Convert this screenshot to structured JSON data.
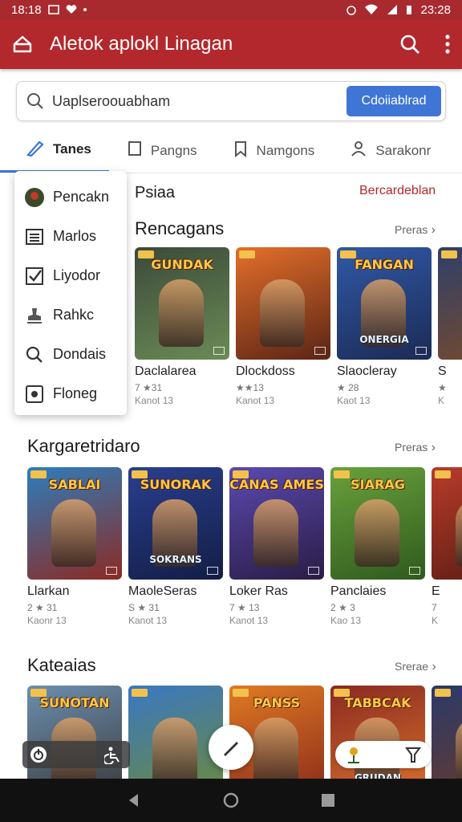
{
  "status_bar": {
    "time_left": "18:18",
    "time_right": "23:28"
  },
  "app_bar": {
    "title": "Aletok aplokl Linagan"
  },
  "search": {
    "value": "Uaplseroouabham",
    "button_label": "Cdoiiablrad"
  },
  "tabs": [
    {
      "label": "Tanes",
      "icon": "pen-icon"
    },
    {
      "label": "Pangns",
      "icon": "page-icon"
    },
    {
      "label": "Namgons",
      "icon": "bookmark-icon"
    },
    {
      "label": "Sarakonr",
      "icon": "person-icon"
    }
  ],
  "menu": {
    "items": [
      {
        "label": "Pencakn",
        "icon": "avatar-icon"
      },
      {
        "label": "Marlos",
        "icon": "list-icon"
      },
      {
        "label": "Liyodor",
        "icon": "checkbox-icon"
      },
      {
        "label": "Rahkc",
        "icon": "stamp-icon"
      },
      {
        "label": "Dondais",
        "icon": "search-icon"
      },
      {
        "label": "Floneg",
        "icon": "radio-icon"
      }
    ]
  },
  "header_row": {
    "label": "Psiaa",
    "link": "Bercardeblan"
  },
  "sections": [
    {
      "title": "Rencagans",
      "more": "Preras",
      "cards": [
        {
          "title": "Daclalarea",
          "rating": "7 ★31",
          "sub": "Kanot 13",
          "art_title": "GUNDAK",
          "art_bottom": "",
          "colors": [
            "#3b4a3a",
            "#6b8b56"
          ]
        },
        {
          "title": "Dlockdoss",
          "rating": "★★13",
          "sub": "Kanot 13",
          "art_title": "",
          "art_bottom": "",
          "colors": [
            "#e46f2a",
            "#5a2416"
          ]
        },
        {
          "title": "Slaocleray",
          "rating": "★ 28",
          "sub": "Kaot 13",
          "art_title": "FANGAN",
          "art_bottom": "ONERGIA",
          "colors": [
            "#3059a6",
            "#1c2a55"
          ]
        },
        {
          "title": "S",
          "rating": "★",
          "sub": "K",
          "art_title": "",
          "art_bottom": "",
          "colors": [
            "#2f3f6a",
            "#7a4b2a"
          ]
        }
      ]
    },
    {
      "title": "Kargaretridaro",
      "more": "Preras",
      "cards": [
        {
          "title": "Llarkan",
          "rating": "2 ★ 31",
          "sub": "Kaonr 13",
          "art_title": "SABLAI",
          "art_bottom": "",
          "colors": [
            "#2d7dbd",
            "#8c2a22"
          ]
        },
        {
          "title": "MaoleSeras",
          "rating": "S ★ 31",
          "sub": "Kanot 13",
          "art_title": "SUNORAK",
          "art_bottom": "SOKRANS",
          "colors": [
            "#2a3f8f",
            "#121d45"
          ]
        },
        {
          "title": "Loker Ras",
          "rating": "7 ★ 13",
          "sub": "Kanot 13",
          "art_title": "CANAS AMES",
          "art_bottom": "",
          "colors": [
            "#5a4ab0",
            "#2a1c45"
          ]
        },
        {
          "title": "Panclaies",
          "rating": "2 ★ 3",
          "sub": "Kao 13",
          "art_title": "SIARAG",
          "art_bottom": "",
          "colors": [
            "#69a13c",
            "#2f5a1d"
          ]
        },
        {
          "title": "E",
          "rating": "7",
          "sub": "K",
          "art_title": "",
          "art_bottom": "",
          "colors": [
            "#b83b2a",
            "#5a1d14"
          ]
        }
      ]
    },
    {
      "title": "Kateaias",
      "more": "Sreraе",
      "cards": [
        {
          "title": "",
          "rating": "",
          "sub": "",
          "art_title": "SUNOTAN",
          "art_bottom": "",
          "colors": [
            "#6c8fb0",
            "#3a3a3a"
          ]
        },
        {
          "title": "",
          "rating": "",
          "sub": "",
          "art_title": "",
          "art_bottom": "",
          "colors": [
            "#3a78c4",
            "#6b8a3a"
          ]
        },
        {
          "title": "",
          "rating": "",
          "sub": "",
          "art_title": "PANSS",
          "art_bottom": "",
          "colors": [
            "#e07a24",
            "#8a2a1a"
          ]
        },
        {
          "title": "",
          "rating": "",
          "sub": "",
          "art_title": "TABBCAK",
          "art_bottom": "GRUDAN",
          "colors": [
            "#8a2a22",
            "#d9702a"
          ]
        },
        {
          "title": "",
          "rating": "",
          "sub": "",
          "art_title": "",
          "art_bottom": "",
          "colors": [
            "#2a3a6a",
            "#6a3a2a"
          ]
        }
      ]
    }
  ],
  "colors": {
    "app_bar": "#b3282d",
    "accent": "#3f76d6",
    "nav_bar": "#111111"
  }
}
